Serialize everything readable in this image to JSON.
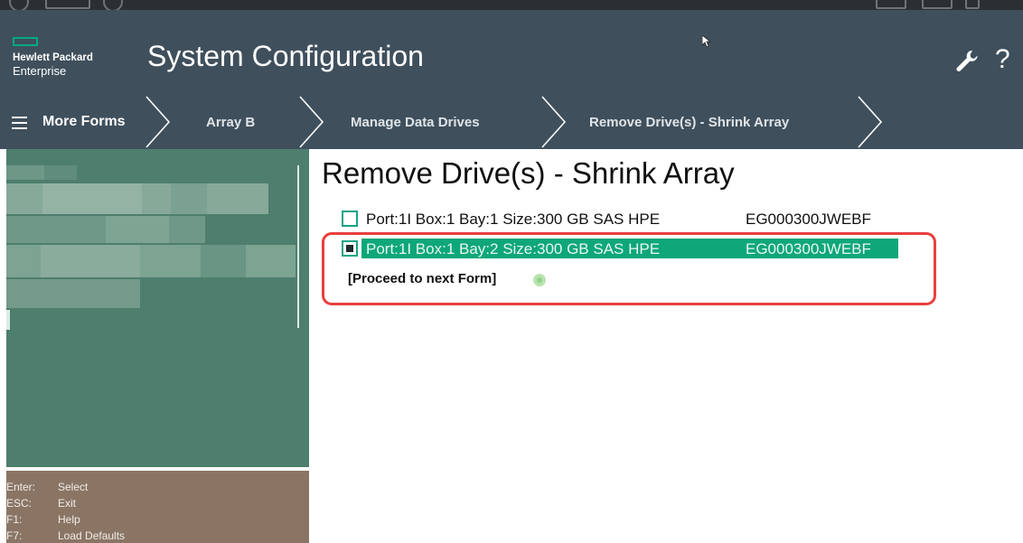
{
  "header": {
    "logo_line1": "Hewlett Packard",
    "logo_line2": "Enterprise",
    "title": "System Configuration",
    "help_label": "?"
  },
  "nav": {
    "menu_label": "More Forms",
    "crumbs": [
      {
        "label": "Array B"
      },
      {
        "label": "Manage Data Drives"
      },
      {
        "label": "Remove Drive(s) - Shrink Array"
      }
    ]
  },
  "main": {
    "page_title": "Remove Drive(s) - Shrink Array",
    "drives": [
      {
        "info": "Port:1I Box:1 Bay:1 Size:300 GB SAS HPE",
        "model": "EG000300JWEBF",
        "checked": false,
        "selected": false
      },
      {
        "info": "Port:1I Box:1 Bay:2 Size:300 GB SAS HPE",
        "model": "EG000300JWEBF",
        "checked": true,
        "selected": true
      }
    ],
    "proceed_label": "[Proceed to next Form]"
  },
  "hints": [
    {
      "key": "Enter:",
      "action": "Select"
    },
    {
      "key": "ESC:",
      "action": "Exit"
    },
    {
      "key": "F1:",
      "action": "Help"
    },
    {
      "key": "F7:",
      "action": "Load Defaults"
    }
  ],
  "colors": {
    "header_bg": "#3f4f5c",
    "accent_green": "#01a982",
    "selection_bg": "#0da779",
    "left_panel_bg": "#4e7e6d",
    "hint_panel_bg": "#8a7565",
    "highlight_border": "#e8403d"
  },
  "icons": {
    "logo": "hpe-logo-rectangle-icon",
    "menu": "hamburger-menu-icon",
    "settings": "wrench-icon",
    "help": "question-mark-icon",
    "cursor": "mouse-pointer-icon",
    "proceed": "green-dot-icon"
  }
}
